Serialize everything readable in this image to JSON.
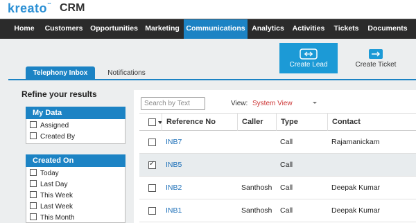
{
  "header": {
    "logo": "kreato",
    "logo_tm": "™",
    "product": "CRM"
  },
  "nav": {
    "items": [
      {
        "label": "Home"
      },
      {
        "label": "Customers"
      },
      {
        "label": "Opportunities"
      },
      {
        "label": "Marketing"
      },
      {
        "label": "Communications",
        "active": true
      },
      {
        "label": "Analytics"
      },
      {
        "label": "Activities"
      },
      {
        "label": "Tickets"
      },
      {
        "label": "Documents"
      }
    ]
  },
  "tabs": [
    {
      "label": "Telephony Inbox",
      "active": true
    },
    {
      "label": "Notifications"
    }
  ],
  "actions": {
    "create_lead": "Create Lead",
    "create_ticket": "Create Ticket"
  },
  "refine": {
    "title": "Refine your results",
    "facets": [
      {
        "title": "My Data",
        "options": [
          "Assigned",
          "Created By"
        ]
      },
      {
        "title": "Created On",
        "options": [
          "Today",
          "Last Day",
          "This Week",
          "Last Week",
          "This Month"
        ]
      }
    ]
  },
  "list": {
    "search_placeholder": "Search by Text",
    "view_label": "View:",
    "view_value": "System View",
    "columns": [
      "Reference No",
      "Caller",
      "Type",
      "Contact"
    ],
    "rows": [
      {
        "ref": "INB7",
        "caller": "",
        "type": "Call",
        "contact": "Rajamanickam",
        "checked": false
      },
      {
        "ref": "INB5",
        "caller": "",
        "type": "Call",
        "contact": "",
        "checked": true
      },
      {
        "ref": "INB2",
        "caller": "Santhosh",
        "type": "Call",
        "contact": "Deepak Kumar",
        "checked": false
      },
      {
        "ref": "INB1",
        "caller": "Santhosh",
        "type": "Call",
        "contact": "Deepak Kumar",
        "checked": false
      }
    ]
  },
  "colors": {
    "accent": "#1c83c4",
    "button": "#1c9ad6",
    "nav_bg": "#2b2b2b",
    "link": "#1c6fb8",
    "view_value": "#c33333"
  }
}
